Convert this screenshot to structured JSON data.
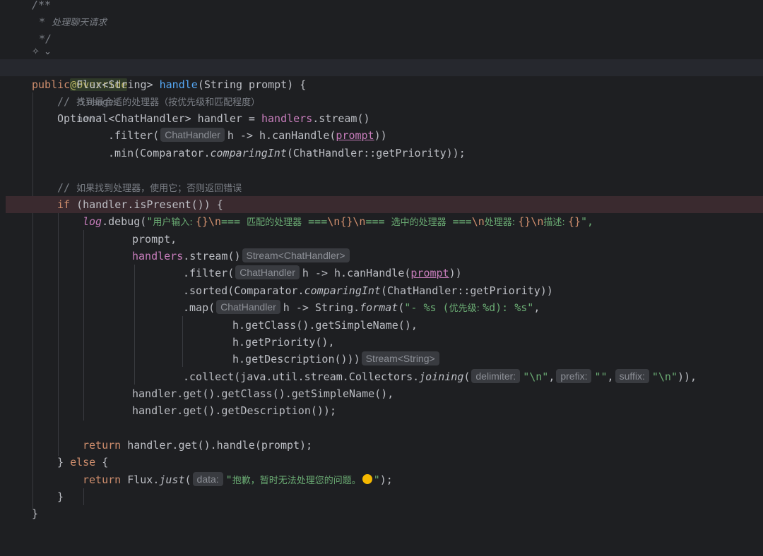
{
  "editor": {
    "lines": {
      "l1": "/**",
      "l2_star": "* ",
      "l2_text": "处理聊天请求",
      "l3": "*/",
      "l4_icon": "rider-icon",
      "l4_chev": "⌄",
      "l5_ann": "@Override",
      "l5_usages": "5 usages",
      "l5_new": "new *",
      "l6_public": "public ",
      "l6_type": "Flux<String> ",
      "l6_name": "handle",
      "l6_rest": "(String prompt) {",
      "l7_prefix": "// ",
      "l7_text": "找到最合适的处理器（按优先级和匹配程度）",
      "l8_a": "Optional<ChatHandler> handler = ",
      "l8_field": "handlers",
      "l8_b": ".stream()",
      "l9_a": ".filter(",
      "l9_hint": "ChatHandler",
      "l9_b": "h -> h.canHandle(",
      "l9_param": "prompt",
      "l9_c": "))",
      "l10_a": ".min(Comparator.",
      "l10_it": "comparingInt",
      "l10_b": "(ChatHandler::getPriority));",
      "l12_prefix": "// ",
      "l12_text": "如果找到处理器，使用它；否则返回错误",
      "l13_kw": "if ",
      "l13_rest": "(handler.isPresent()) {",
      "l14_log": "log",
      "l14_a": ".debug(",
      "l14_q": "\"",
      "l14_s1": "用户输入: ",
      "l14_s2": "{}",
      "l14_e1": "\\n",
      "l14_s3": "=== ",
      "l14_s4": "匹配的处理器",
      "l14_s5": " ===",
      "l14_e2": "\\n",
      "l14_s6": "{}",
      "l14_e3": "\\n",
      "l14_s7": "=== ",
      "l14_s8": "选中的处理器",
      "l14_s9": " ===",
      "l14_e4": "\\n",
      "l14_s10": "处理器: ",
      "l14_s11": "{}",
      "l14_e5": "\\n",
      "l14_s12": "描述: ",
      "l14_s13": "{}",
      "l14_q2": "\",",
      "l15": "prompt,",
      "l16_field": "handlers",
      "l16_a": ".stream()",
      "l16_hint": "Stream<ChatHandler>",
      "l17_a": ".filter(",
      "l17_hint": "ChatHandler",
      "l17_b": "h -> h.canHandle(",
      "l17_param": "prompt",
      "l17_c": "))",
      "l18_a": ".sorted(Comparator.",
      "l18_it": "comparingInt",
      "l18_b": "(ChatHandler::getPriority))",
      "l19_a": ".map(",
      "l19_hint": "ChatHandler",
      "l19_b": "h -> String.",
      "l19_it": "format",
      "l19_c": "(",
      "l19_s1": "\"- %s (",
      "l19_s2": "优先级: ",
      "l19_s3": "%d): %s\"",
      "l19_d": ",",
      "l20": "h.getClass().getSimpleName(),",
      "l21": "h.getPriority(),",
      "l22_a": "h.getDescription()))",
      "l22_hint": "Stream<String>",
      "l23_a": ".collect(java.util.stream.Collectors.",
      "l23_it": "joining",
      "l23_b": "(",
      "l23_h1": "delimiter:",
      "l23_s1": "\"\\n\"",
      "l23_c1": ",",
      "l23_h2": "prefix:",
      "l23_s2": "\"\"",
      "l23_c2": ",",
      "l23_h3": "suffix:",
      "l23_s3": "\"\\n\"",
      "l23_d": ")),",
      "l24": "handler.get().getClass().getSimpleName(),",
      "l25": "handler.get().getDescription());",
      "l27_kw": "return ",
      "l27_rest": "handler.get().handle(prompt);",
      "l28_a": "} ",
      "l28_kw": "else",
      "l28_b": " {",
      "l29_kw": "return ",
      "l29_a": "Flux.",
      "l29_it": "just",
      "l29_b": "(",
      "l29_hint": "data:",
      "l29_s1": "\"",
      "l29_s2": "抱歉，暂时无法处理您的问题。",
      "l29_emoji": "smiling-face-emoji",
      "l29_s3": "\"",
      "l29_c": ");",
      "l30": "}",
      "l31": "}"
    }
  }
}
